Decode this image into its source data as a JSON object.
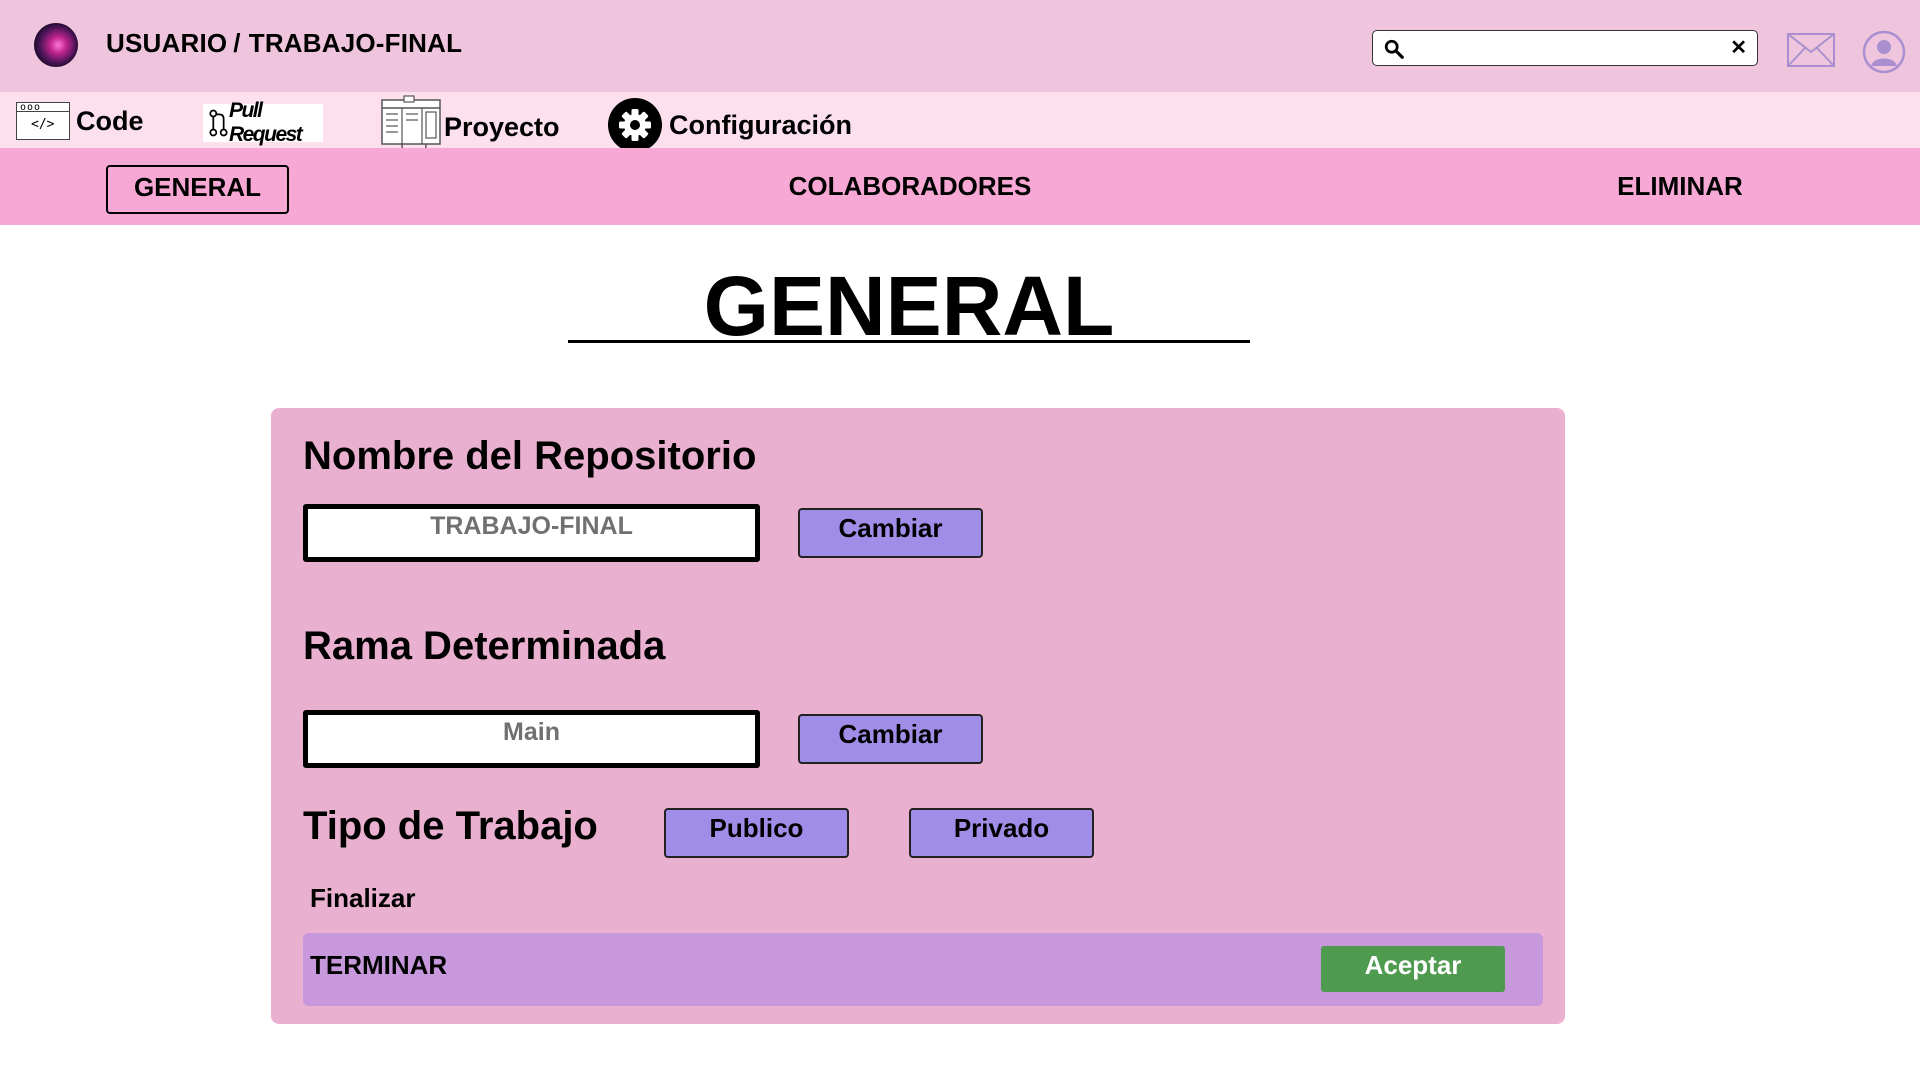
{
  "header": {
    "user": "USUARIO",
    "separator": "/",
    "repo": "TRABAJO-FINAL",
    "search": {
      "value": "",
      "placeholder": "",
      "clear_glyph": "✕"
    },
    "icons": [
      "logo-icon",
      "search-icon",
      "close-icon",
      "mail-icon",
      "user-avatar-icon"
    ]
  },
  "nav": {
    "code": "Code",
    "pull_request": "Pull Request",
    "project": "Proyecto",
    "settings": "Configuración"
  },
  "tabs": {
    "general": "GENERAL",
    "collaborators": "COLABORADORES",
    "delete": "ELIMINAR"
  },
  "page": {
    "title": "GENERAL"
  },
  "form": {
    "repo_name": {
      "label": "Nombre del Repositorio",
      "value": "TRABAJO-FINAL",
      "button": "Cambiar"
    },
    "default_branch": {
      "label": "Rama Determinada",
      "value": "Main",
      "button": "Cambiar"
    },
    "work_type": {
      "label": "Tipo de Trabajo",
      "public": "Publico",
      "private": "Privado"
    },
    "finish": {
      "label": "Finalizar",
      "bar_label": "TERMINAR",
      "accept": "Aceptar"
    }
  },
  "colors": {
    "header_bg": "#eec5dd",
    "nav_bg": "#fde0ee",
    "tabs_bg": "#f7a8d4",
    "panel_bg": "#eab0d0",
    "button_purple": "#9f8de8",
    "terminar_bg": "#c898dc",
    "accept_green": "#4e9a4e"
  }
}
